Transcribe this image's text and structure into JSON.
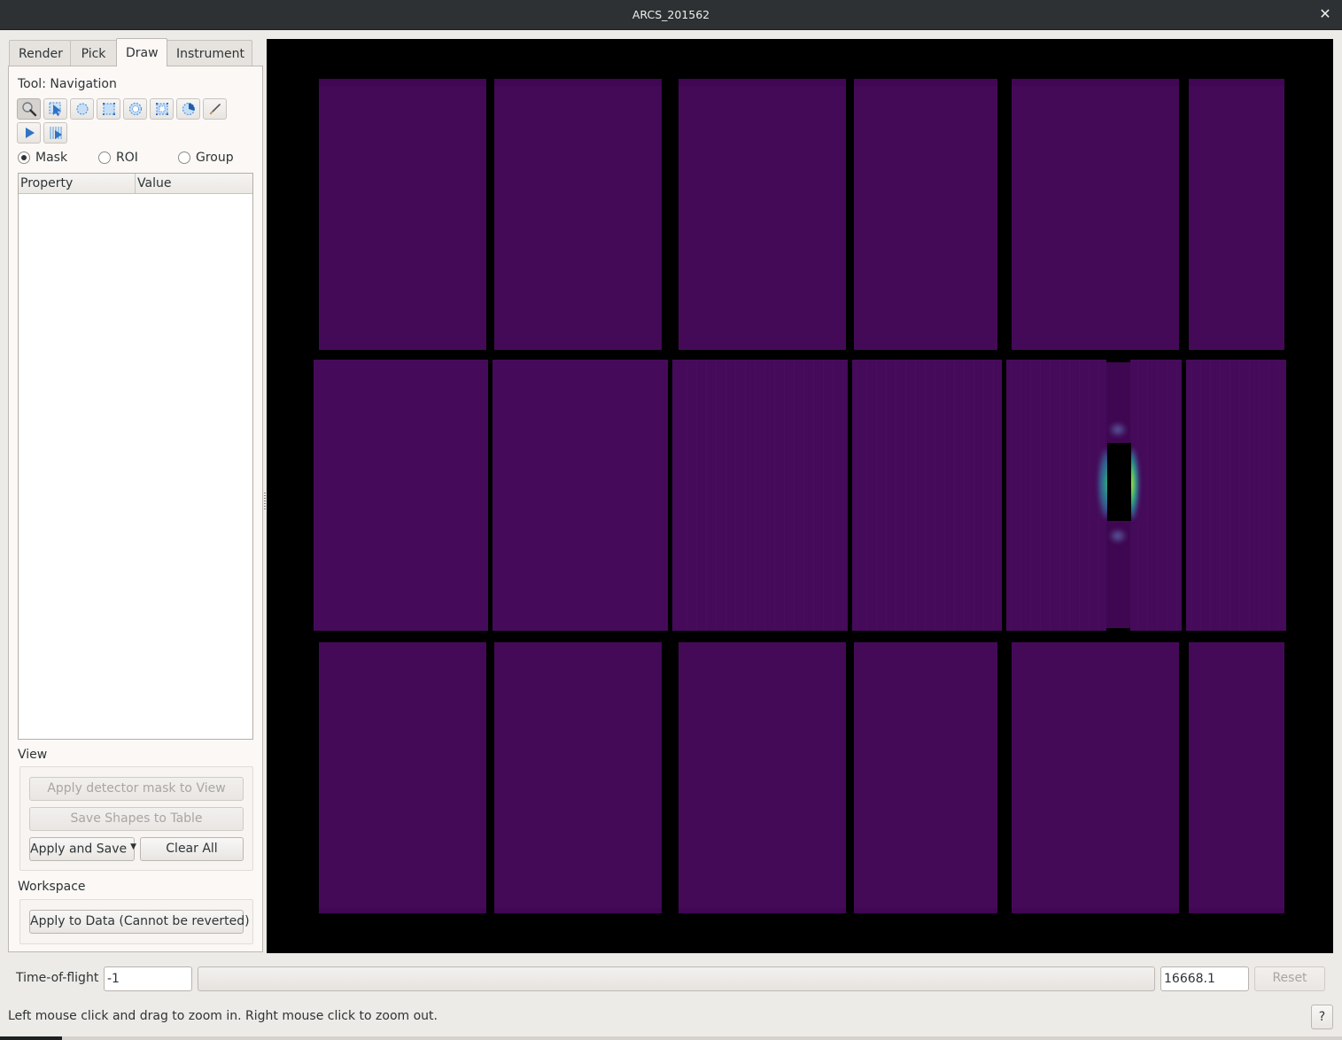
{
  "window": {
    "title": "ARCS_201562",
    "close_icon": "close-icon"
  },
  "tabs": [
    {
      "label": "Render",
      "active": false
    },
    {
      "label": "Pick",
      "active": false
    },
    {
      "label": "Draw",
      "active": true
    },
    {
      "label": "Instrument",
      "active": false
    }
  ],
  "draw_panel": {
    "tool_label": "Tool: Navigation",
    "tools": [
      {
        "name": "zoom-navigation-icon",
        "pressed": true
      },
      {
        "name": "edit-select-icon",
        "pressed": false
      },
      {
        "name": "draw-ellipse-icon",
        "pressed": false
      },
      {
        "name": "draw-rectangle-icon",
        "pressed": false
      },
      {
        "name": "draw-ring-ellipse-icon",
        "pressed": false
      },
      {
        "name": "draw-ring-rectangle-icon",
        "pressed": false
      },
      {
        "name": "draw-sector-icon",
        "pressed": false
      },
      {
        "name": "draw-freehand-icon",
        "pressed": false
      },
      {
        "name": "pixel-select-icon",
        "pressed": false
      },
      {
        "name": "tube-select-icon",
        "pressed": false
      }
    ],
    "mode_options": [
      {
        "label": "Mask",
        "checked": true
      },
      {
        "label": "ROI",
        "checked": false
      },
      {
        "label": "Group",
        "checked": false
      }
    ],
    "property_table": {
      "columns": [
        "Property",
        "Value"
      ],
      "rows": []
    },
    "view_section": {
      "label": "View",
      "apply_mask_button": "Apply detector mask to View",
      "save_shapes_button": "Save Shapes to Table",
      "apply_and_save_button": "Apply and Save",
      "clear_all_button": "Clear All"
    },
    "workspace_section": {
      "label": "Workspace",
      "apply_to_data_button": "Apply to Data (Cannot be reverted)"
    }
  },
  "instrument_view": {
    "instrument": "ARCS",
    "colormap_colors": {
      "background": "#000000",
      "low": "#440a57",
      "peak_green": "#35b779",
      "peak_yellow": "#fde725",
      "peak_blue": "#3b528b"
    },
    "detector_rows": 3,
    "detector_panels_per_row": 6
  },
  "time_of_flight": {
    "label": "Time-of-flight",
    "min_value": "-1",
    "max_value": "16668.1",
    "reset_button": "Reset"
  },
  "status_bar": {
    "message": "Left mouse click and drag to zoom in. Right mouse click to zoom out.",
    "help_button": "?"
  }
}
